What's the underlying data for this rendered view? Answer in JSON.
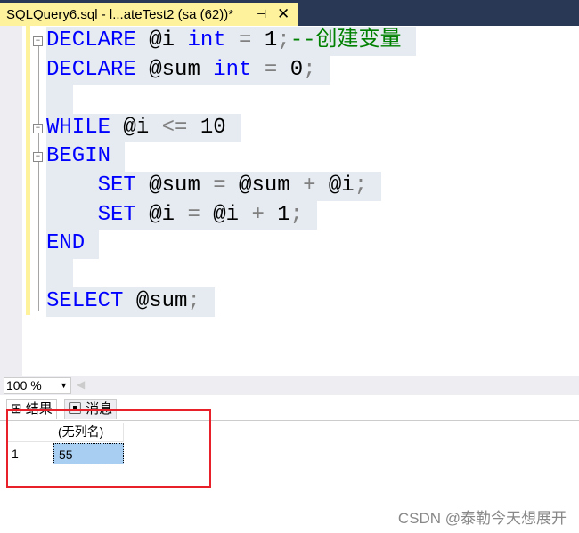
{
  "tab": {
    "title": "SQLQuery6.sql - l...ateTest2 (sa (62))*",
    "pin_icon": "pin-icon",
    "close_icon": "close-icon"
  },
  "code": [
    [
      {
        "t": "DECLARE",
        "c": "kw"
      },
      {
        "t": " @i ",
        "c": "id"
      },
      {
        "t": "int",
        "c": "kw"
      },
      {
        "t": " = ",
        "c": "op"
      },
      {
        "t": "1",
        "c": "id"
      },
      {
        "t": ";",
        "c": "op"
      },
      {
        "t": "--创建变量",
        "c": "cm"
      }
    ],
    [
      {
        "t": "DECLARE",
        "c": "kw"
      },
      {
        "t": " @sum ",
        "c": "id"
      },
      {
        "t": "int",
        "c": "kw"
      },
      {
        "t": " = ",
        "c": "op"
      },
      {
        "t": "0",
        "c": "id"
      },
      {
        "t": ";",
        "c": "op"
      }
    ],
    [],
    [
      {
        "t": "WHILE",
        "c": "kw"
      },
      {
        "t": " @i ",
        "c": "id"
      },
      {
        "t": "<=",
        "c": "op"
      },
      {
        "t": " 10",
        "c": "id"
      }
    ],
    [
      {
        "t": "BEGIN",
        "c": "kw"
      }
    ],
    [
      {
        "t": "    SET",
        "c": "kw"
      },
      {
        "t": " @sum ",
        "c": "id"
      },
      {
        "t": "=",
        "c": "op"
      },
      {
        "t": " @sum ",
        "c": "id"
      },
      {
        "t": "+",
        "c": "op"
      },
      {
        "t": " @i",
        "c": "id"
      },
      {
        "t": ";",
        "c": "op"
      }
    ],
    [
      {
        "t": "    SET",
        "c": "kw"
      },
      {
        "t": " @i ",
        "c": "id"
      },
      {
        "t": "=",
        "c": "op"
      },
      {
        "t": " @i ",
        "c": "id"
      },
      {
        "t": "+",
        "c": "op"
      },
      {
        "t": " 1",
        "c": "id"
      },
      {
        "t": ";",
        "c": "op"
      }
    ],
    [
      {
        "t": "END",
        "c": "kw"
      }
    ],
    [],
    [
      {
        "t": "SELECT",
        "c": "kw"
      },
      {
        "t": " @sum",
        "c": "id"
      },
      {
        "t": ";",
        "c": "op"
      }
    ]
  ],
  "folds": [
    0,
    3,
    4
  ],
  "zoom": {
    "value": "100 %"
  },
  "results_tabs": [
    {
      "label": "结果",
      "icon": "grid-icon"
    },
    {
      "label": "消息",
      "icon": "message-icon"
    }
  ],
  "grid": {
    "columns": [
      "(无列名)"
    ],
    "rows": [
      {
        "num": "1",
        "values": [
          "55"
        ]
      }
    ]
  },
  "colors": {
    "keyword": "#0000ff",
    "comment": "#008000",
    "operator": "#808080",
    "tab": "#fff29d",
    "selection": "#e5ebf1",
    "highlight_box": "#e8202a"
  },
  "watermark": "CSDN @泰勒今天想展开"
}
